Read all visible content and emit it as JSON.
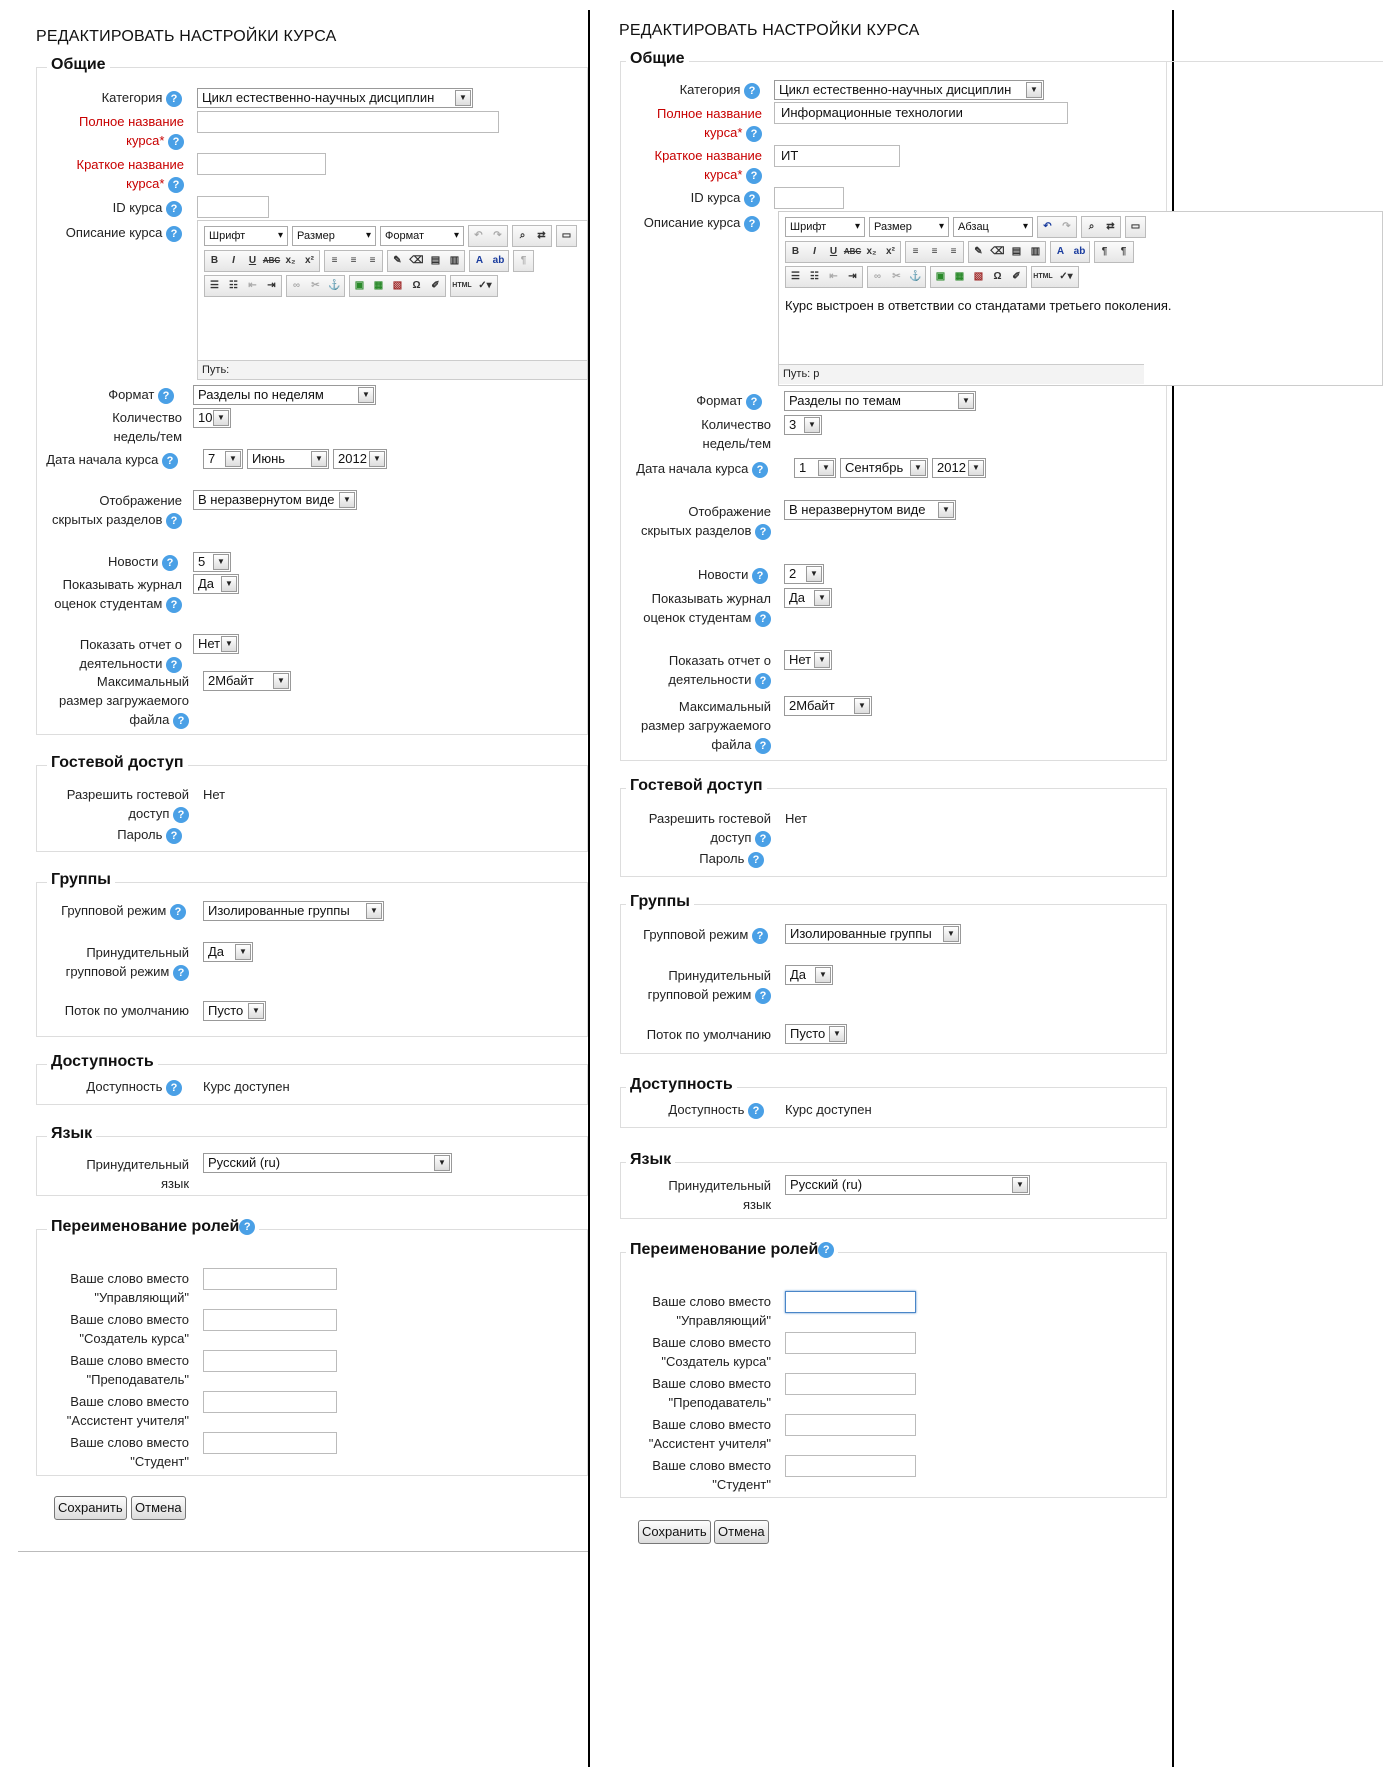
{
  "page_title": "РЕДАКТИРОВАТЬ НАСТРОЙКИ КУРСА",
  "help_glyph": "?",
  "required_mark": "*",
  "accent_color": "#4aa0e6",
  "required_color": "#c80000",
  "sections": {
    "general": "Общие",
    "guest": "Гостевой доступ",
    "groups": "Группы",
    "availability": "Доступность",
    "language": "Язык",
    "roles": "Переименование ролей"
  },
  "labels": {
    "category": "Категория",
    "fullname_1": "Полное название",
    "fullname_2": "курса",
    "shortname_1": "Краткое название",
    "shortname_2": "курса",
    "idnumber": "ID курса",
    "summary": "Описание курса",
    "format": "Формат",
    "numsections_1": "Количество",
    "numsections_2": "недель/тем",
    "startdate": "Дата начала курса",
    "hidden_1": "Отображение",
    "hidden_2": "скрытых разделов",
    "news": "Новости",
    "grades_1": "Показывать журнал",
    "grades_2": "оценок студентам",
    "reports_1": "Показать отчет о",
    "reports_2": "деятельности",
    "maxbytes_1": "Максимальный",
    "maxbytes_2": "размер загружаемого",
    "maxbytes_3": "файла",
    "guest_1": "Разрешить гостевой",
    "guest_2": "доступ",
    "password": "Пароль",
    "groupmode": "Групповой режим",
    "forcegroup_1": "Принудительный",
    "forcegroup_2": "групповой режим",
    "grouping": "Поток по умолчанию",
    "visible": "Доступность",
    "lang_1": "Принудительный",
    "lang_2": "язык",
    "role_prefix": "Ваше слово вместо",
    "role_manager": "\"Управляющий\"",
    "role_coursecreator": "\"Создатель курса\"",
    "role_teacher": "\"Преподаватель\"",
    "role_assistant": "\"Ассистент учителя\"",
    "role_student": "\"Студент\""
  },
  "editor": {
    "font": "Шрифт",
    "size": "Размер",
    "format_left": "Формат",
    "format_right": "Абзац",
    "path_left": "Путь:",
    "path_right": "Путь: p",
    "btn_bold": "B",
    "btn_italic": "I",
    "btn_underline": "U",
    "btn_strike": "ABC",
    "btn_sub": "x₂",
    "btn_sup": "x²",
    "btn_omega": "Ω",
    "btn_html": "HTML"
  },
  "left": {
    "category": "Цикл естественно-научных дисциплин",
    "fullname": "",
    "shortname": "",
    "idnumber": "",
    "summary": "",
    "format": "Разделы по неделям",
    "numsections": "10",
    "day": "7",
    "month": "Июнь",
    "year": "2012",
    "hidden": "В неразвернутом виде",
    "news": "5",
    "grades": "Да",
    "reports": "Нет",
    "maxbytes": "2Мбайт",
    "guest": "Нет",
    "groupmode": "Изолированные группы",
    "forcegroup": "Да",
    "grouping": "Пусто",
    "visible": "Курс доступен",
    "lang": "Русский (ru)"
  },
  "right": {
    "category": "Цикл естественно-научных дисциплин",
    "fullname": "Информационные технологии",
    "shortname": "ИТ",
    "idnumber": "",
    "summary": "Курс выстроен в ответствии со стандатами третьего поколения.",
    "format": "Разделы по темам",
    "numsections": "3",
    "day": "1",
    "month": "Сентябрь",
    "year": "2012",
    "hidden": "В неразвернутом виде",
    "news": "2",
    "grades": "Да",
    "reports": "Нет",
    "maxbytes": "2Мбайт",
    "guest": "Нет",
    "groupmode": "Изолированные группы",
    "forcegroup": "Да",
    "grouping": "Пусто",
    "visible": "Курс доступен",
    "lang": "Русский (ru)"
  },
  "buttons": {
    "save": "Сохранить",
    "cancel": "Отмена"
  }
}
